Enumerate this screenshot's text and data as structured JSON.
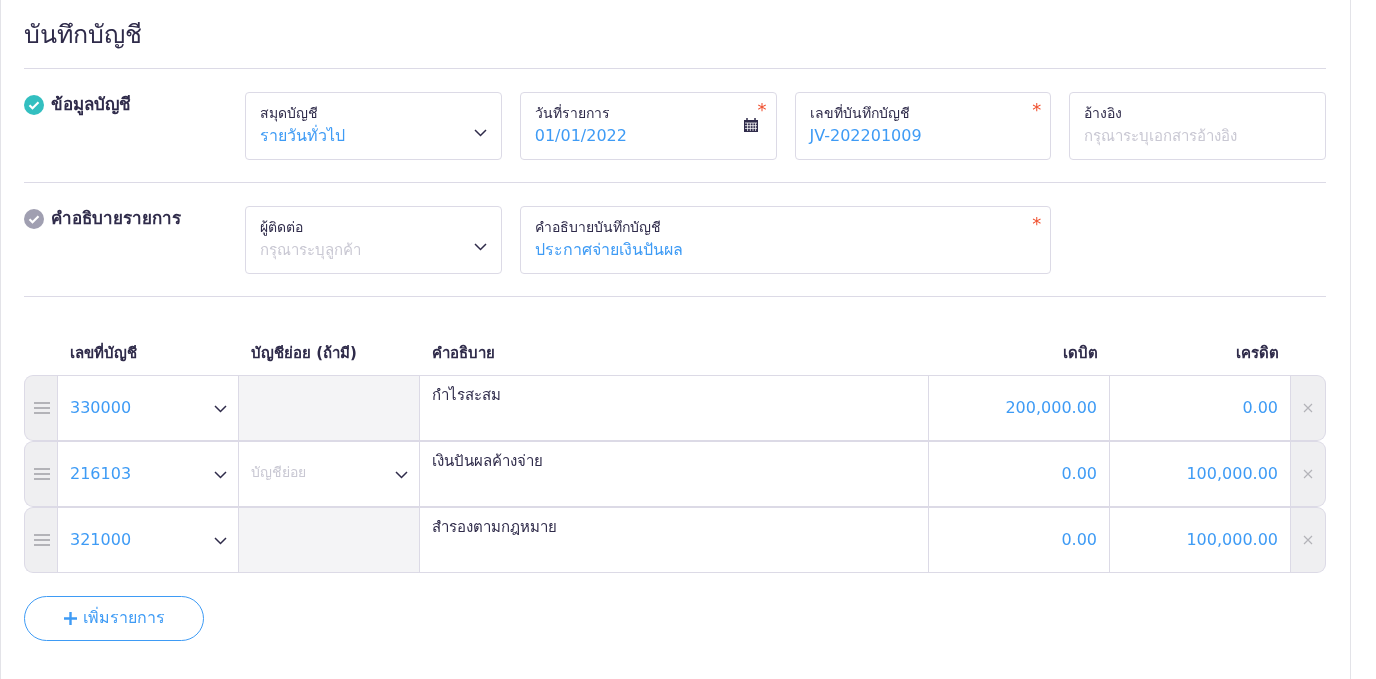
{
  "title": "บันทึกบัญชี",
  "sections": [
    {
      "label": "ข้อมูลบัญชี",
      "completed": true,
      "fields": [
        {
          "kind": "select",
          "label": "สมุดบัญชี",
          "value": "รายวันทั่วไป"
        },
        {
          "kind": "date",
          "label": "วันที่รายการ",
          "value": "01/01/2022",
          "required_mark": "*"
        },
        {
          "kind": "text",
          "label": "เลขที่บันทึกบัญชี",
          "value": "JV-202201009",
          "required_mark": "*"
        },
        {
          "kind": "text",
          "label": "อ้างอิง",
          "placeholder": "กรุณาระบุเอกสารอ้างอิง"
        }
      ]
    },
    {
      "label": "คำอธิบายรายการ",
      "completed": false,
      "fields": [
        {
          "kind": "select",
          "label": "ผู้ติดต่อ",
          "placeholder": "กรุณาระบุลูกค้า"
        },
        {
          "kind": "text",
          "label": "คำอธิบายบันทึกบัญชี",
          "value": "ประกาศจ่ายเงินปันผล",
          "required_mark": "*"
        }
      ]
    }
  ],
  "table": {
    "columns": [
      "เลขที่บัญชี",
      "บัญชีย่อย (ถ้ามี)",
      "คำอธิบาย",
      "เดบิต",
      "เครดิต"
    ],
    "rows": [
      {
        "account": "330000",
        "sub_account": {
          "disabled": true
        },
        "description": "กำไรสะสม",
        "debit": "200,000.00",
        "credit": "0.00"
      },
      {
        "account": "216103",
        "sub_account": {
          "disabled": false,
          "placeholder": "บัญชีย่อย"
        },
        "description": "เงินปันผลค้างจ่าย",
        "debit": "0.00",
        "credit": "100,000.00"
      },
      {
        "account": "321000",
        "sub_account": {
          "disabled": true
        },
        "description": "สำรองตามกฎหมาย",
        "debit": "0.00",
        "credit": "100,000.00"
      }
    ]
  },
  "add_button": "เพิ่มรายการ"
}
